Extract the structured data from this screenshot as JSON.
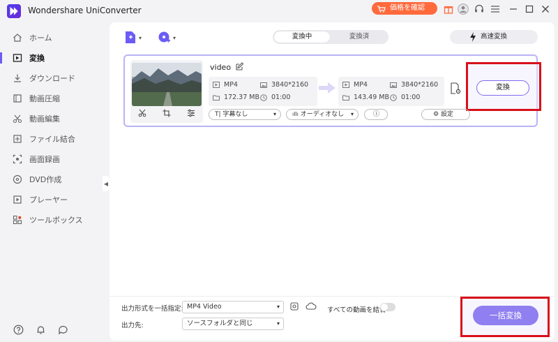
{
  "app": {
    "title": "Wondershare UniConverter",
    "price_label": "価格を確認"
  },
  "sidebar": {
    "items": [
      {
        "label": "ホーム",
        "icon": "home-icon"
      },
      {
        "label": "変換",
        "icon": "convert-icon",
        "active": true
      },
      {
        "label": "ダウンロード",
        "icon": "download-icon"
      },
      {
        "label": "動画圧縮",
        "icon": "compress-icon"
      },
      {
        "label": "動画編集",
        "icon": "scissors-icon"
      },
      {
        "label": "ファイル結合",
        "icon": "merge-icon"
      },
      {
        "label": "画面録画",
        "icon": "record-icon"
      },
      {
        "label": "DVD作成",
        "icon": "dvd-icon"
      },
      {
        "label": "プレーヤー",
        "icon": "player-icon"
      },
      {
        "label": "ツールボックス",
        "icon": "toolbox-icon"
      }
    ]
  },
  "tabs": {
    "converting": "変換中",
    "converted": "変換済"
  },
  "speed_label": "高速変換",
  "file": {
    "title": "video",
    "source": {
      "format": "MP4",
      "resolution": "3840*2160",
      "size": "172.37 MB",
      "duration": "01:00"
    },
    "target": {
      "format": "MP4",
      "resolution": "3840*2160",
      "size": "143.49 MB",
      "duration": "01:00"
    },
    "convert_label": "変換",
    "subtitle": "字幕なし",
    "audio": "オーディオなし",
    "settings_label": "設定"
  },
  "footer": {
    "output_format_label": "出力形式を一括指定:",
    "output_format_value": "MP4 Video",
    "merge_label": "すべての動画を結合",
    "output_dest_label": "出力先:",
    "output_dest_value": "ソースフォルダと同じ",
    "batch_convert_label": "一括変換"
  },
  "colors": {
    "accent": "#8f7ff0",
    "highlight": "#d9101a",
    "price": "#ff6a3d"
  }
}
